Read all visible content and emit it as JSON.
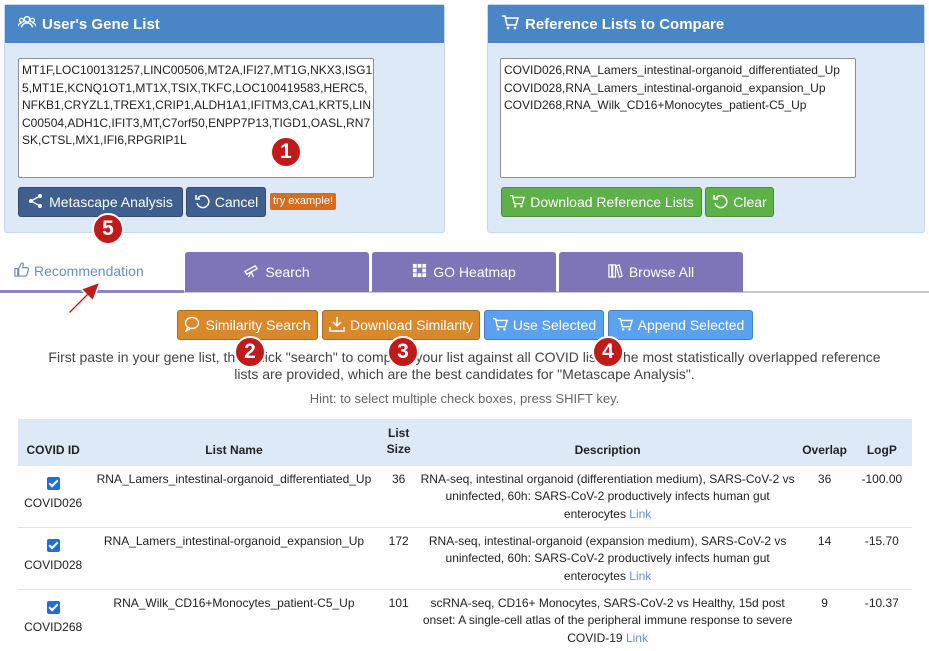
{
  "user_panel": {
    "title": "User's Gene List",
    "gene_lines": [
      "MT1F,LOC100131257,LINC00506,MT2A,IFI27,MT1G,NKX3,ISG1",
      "5,MT1E,KCNQ1OT1,MT1X,TSIX,TKFC,LOC100419583,HERC5,",
      "NFKB1,CRYZL1,TREX1,CRIP1,ALDH1A1,IFITM3,CA1,KRT5,LIN",
      "C00504,ADH1C,IFIT3,MT,C7orf50,ENPP7P13,TIGD1,OASL,RN7",
      "SK,CTSL,MX1,IFI6,RPGRIP1L"
    ],
    "metascape_label": "Metascape Analysis",
    "cancel_label": "Cancel",
    "try_label": "try example!"
  },
  "ref_panel": {
    "title": "Reference Lists to Compare",
    "lines": [
      "COVID026,RNA_Lamers_intestinal-organoid_differentiated_Up",
      "COVID028,RNA_Lamers_intestinal-organoid_expansion_Up",
      "COVID268,RNA_Wilk_CD16+Monocytes_patient-C5_Up"
    ],
    "download_label": "Download Reference Lists",
    "clear_label": "Clear"
  },
  "tabs": {
    "recommendation": "Recommendation",
    "search": "Search",
    "heatmap": "GO Heatmap",
    "browse": "Browse All"
  },
  "actions": {
    "similarity_search": "Similarity Search",
    "download_similarity": "Download Similarity",
    "use_selected": "Use Selected",
    "append_selected": "Append Selected"
  },
  "info_line1": "First paste in your gene list, then click \"search\" to compare your list against all COVID lists. The most statistically overlapped reference",
  "info_line2": "lists are provided, which are the best candidates for \"Metascape Analysis\".",
  "hint": "Hint: to select multiple check boxes, press SHIFT key.",
  "badges": [
    "1",
    "2",
    "3",
    "4",
    "5"
  ],
  "table": {
    "headers": {
      "covid_id": "COVID ID",
      "list_name": "List Name",
      "list_size_1": "List",
      "list_size_2": "Size",
      "description": "Description",
      "overlap": "Overlap",
      "logp": "LogP"
    },
    "rows": [
      {
        "checked": true,
        "id": "COVID026",
        "name": "RNA_Lamers_intestinal-organoid_differentiated_Up",
        "size": "36",
        "desc1": "RNA-seq, intestinal organoid (differentiation medium), SARS-CoV-2 vs",
        "desc2": "uninfected, 60h: SARS-CoV-2 productively infects human gut",
        "desc3": "enterocytes",
        "link": "Link",
        "overlap": "36",
        "logp": "-100.00"
      },
      {
        "checked": true,
        "id": "COVID028",
        "name": "RNA_Lamers_intestinal-organoid_expansion_Up",
        "size": "172",
        "desc1": "RNA-seq, intestinal-organoid (expansion medium), SARS-CoV-2 vs",
        "desc2": "uninfected, 60h: SARS-CoV-2 productively infects human gut",
        "desc3": "enterocytes",
        "link": "Link",
        "overlap": "14",
        "logp": "-15.70"
      },
      {
        "checked": true,
        "id": "COVID268",
        "name": "RNA_Wilk_CD16+Monocytes_patient-C5_Up",
        "size": "101",
        "desc1": "scRNA-seq, CD16+ Monocytes, SARS-CoV-2 vs Healthy, 15d post",
        "desc2": "onset: A single-cell atlas of the peripheral immune response to severe",
        "desc3": "COVID-19",
        "link": "Link",
        "overlap": "9",
        "logp": "-10.37"
      }
    ]
  },
  "colors": {
    "panel_header": "#4a86c5",
    "panel_bg": "#dde9f6",
    "tab_purple": "#7e75b8",
    "btn_green": "#5db148",
    "btn_orange": "#d9882a",
    "btn_blue": "#5aa2f0",
    "badge_red": "#c11a1a"
  }
}
